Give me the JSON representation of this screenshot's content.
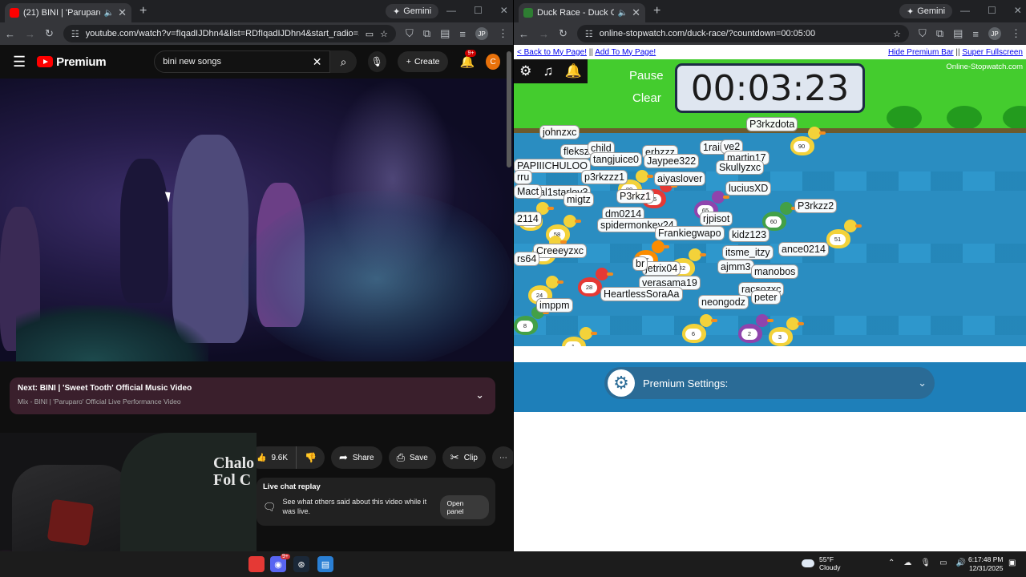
{
  "left_browser": {
    "tab_title": "(21) BINI | 'Paruparo' Official",
    "gemini_label": "Gemini",
    "url": "youtube.com/watch?v=fIqadIJDhn4&list=RDfIqadIJDhn4&start_radio=1"
  },
  "right_browser": {
    "tab_title": "Duck Race - Duck Games",
    "gemini_label": "Gemini",
    "url": "online-stopwatch.com/duck-race/?countdown=00:05:00"
  },
  "profile_initials": "JP",
  "youtube": {
    "logo_text": "Premium",
    "search_value": "bini new songs",
    "create_label": "Create",
    "notification_badge": "9+",
    "avatar_letter": "C",
    "next_title": "Next: BINI | 'Sweet Tooth' Official Music Video",
    "next_subtitle": "Mix - BINI | 'Paruparo' Official Live Performance Video",
    "like_count": "9.6K",
    "share_label": "Share",
    "save_label": "Save",
    "clip_label": "Clip",
    "chat_replay_title": "Live chat replay",
    "chat_replay_desc": "See what others said about this video while it was live.",
    "open_panel_label": "Open panel"
  },
  "webcam": {
    "shirt_text_line1": "Chalo",
    "shirt_text_line2": "Fol C"
  },
  "duck_race": {
    "back_link": "< Back to My Page!",
    "separator": "||",
    "add_link": "Add To My Page!",
    "hide_premium": "Hide Premium Bar",
    "super_fullscreen": "Super Fullscreen",
    "pause_label": "Pause",
    "clear_label": "Clear",
    "timer": "00:03:23",
    "brand": "Online-Stopwatch.com",
    "premium_settings": "Premium Settings:",
    "racers": [
      "johnzxc",
      "P3rkzdota",
      "fleksz",
      "child",
      "erbzzz",
      "1raiii",
      "ve2",
      "tangjuice0",
      "martin17",
      "PAPIIICHULOO",
      "p3rkzzz1",
      "Jaypee322",
      "Skullyzxc",
      "aiyaslover",
      "luciusXD",
      "al1starlov3",
      "P3rkz1",
      "migtz",
      "P3rkzz2",
      "2114",
      "dm0214",
      "rjpisot",
      "spidermonkey24",
      "Frankiegwapo",
      "kidz123",
      "Creeeyzxc",
      "rs64",
      "itsme_itzy",
      "ajmm3",
      "ance0214",
      "jetrix04",
      "manobos",
      "verasama19",
      "racsozxc",
      "HeartlessSoraAa",
      "neongodz",
      "peter",
      "imppm",
      "Mact",
      "rru",
      "br"
    ],
    "duck_numbers": [
      "90",
      "80",
      "75",
      "62",
      "65",
      "58",
      "60",
      "43",
      "47",
      "42",
      "51",
      "24",
      "28",
      "6",
      "2",
      "3",
      "8",
      "1"
    ]
  },
  "taskbar": {
    "discord_badge": "9+",
    "temperature": "55°F",
    "condition": "Cloudy",
    "time": "6:17:48 PM",
    "date": "12/31/2025"
  }
}
